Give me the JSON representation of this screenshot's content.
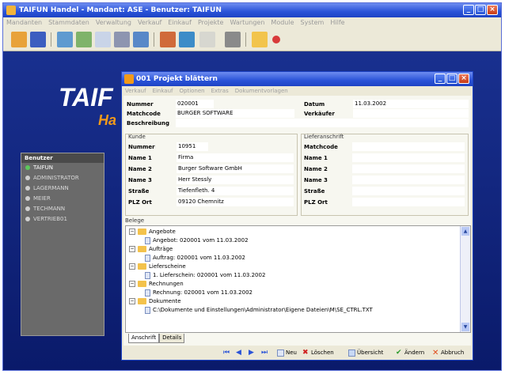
{
  "app": {
    "title": "TAIFUN Handel - Mandant: ASE - Benutzer: TAIFUN",
    "menu": [
      "Mandanten",
      "Stammdaten",
      "Verwaltung",
      "Verkauf",
      "Einkauf",
      "Projekte",
      "Wartungen",
      "Module",
      "System",
      "Hilfe"
    ],
    "brand_line1": "TAIF",
    "brand_line2": "Ha",
    "toolbar_icons": [
      "folder-icon",
      "book-icon",
      "people-icon",
      "chart-icon",
      "document-icon",
      "car-icon",
      "box-icon",
      "archive-icon",
      "calendar-icon",
      "gray-book-icon",
      "folder-plus-icon",
      "pin-icon"
    ]
  },
  "users": {
    "heading": "Benutzer",
    "items": [
      {
        "name": "TAIFUN",
        "active": true
      },
      {
        "name": "ADMINISTRATOR",
        "active": false
      },
      {
        "name": "LAGERMANN",
        "active": false
      },
      {
        "name": "MEIER",
        "active": false
      },
      {
        "name": "TECHMANN",
        "active": false
      },
      {
        "name": "VERTRIEB01",
        "active": false
      }
    ]
  },
  "dialog": {
    "title": "001 Projekt blättern",
    "menu": [
      "Verkauf",
      "Einkauf",
      "Optionen",
      "Extras",
      "Dokumentvorlagen"
    ],
    "header": {
      "nummer_label": "Nummer",
      "nummer": "020001",
      "datum_label": "Datum",
      "datum": "11.03.2002",
      "matchcode_label": "Matchcode",
      "matchcode": "BURGER SOFTWARE",
      "verkaeufer_label": "Verkäufer",
      "verkaeufer": "",
      "beschreibung_label": "Beschreibung",
      "beschreibung": ""
    },
    "kunde": {
      "title": "Kunde",
      "rows": [
        {
          "label": "Nummer",
          "value": "10951"
        },
        {
          "label": "Name 1",
          "value": "Firma"
        },
        {
          "label": "Name 2",
          "value": "Burger Software GmbH"
        },
        {
          "label": "Name 3",
          "value": "Herr Stessly"
        },
        {
          "label": "Straße",
          "value": "Tiefenfleth. 4"
        },
        {
          "label": "PLZ Ort",
          "value": "09120 Chemnitz"
        }
      ]
    },
    "lieferanschrift": {
      "title": "Lieferanschrift",
      "rows": [
        {
          "label": "Matchcode",
          "value": ""
        },
        {
          "label": "Name 1",
          "value": ""
        },
        {
          "label": "Name 2",
          "value": ""
        },
        {
          "label": "Name 3",
          "value": ""
        },
        {
          "label": "Straße",
          "value": ""
        },
        {
          "label": "PLZ Ort",
          "value": ""
        }
      ]
    },
    "belege": {
      "title": "Belege",
      "tree": [
        {
          "level": 0,
          "text": "Angebote"
        },
        {
          "level": 1,
          "text": "Angebot: 020001 vom 11.03.2002"
        },
        {
          "level": 0,
          "text": "Aufträge"
        },
        {
          "level": 1,
          "text": "Auftrag: 020001 vom 11.03.2002"
        },
        {
          "level": 0,
          "text": "Lieferscheine"
        },
        {
          "level": 1,
          "text": "1. Lieferschein: 020001 vom 11.03.2002"
        },
        {
          "level": 0,
          "text": "Rechnungen"
        },
        {
          "level": 1,
          "text": "Rechnung: 020001 vom 11.03.2002"
        },
        {
          "level": 0,
          "text": "Dokumente"
        },
        {
          "level": 1,
          "text": "C:\\Dokumente und Einstellungen\\Administrator\\Eigene Dateien\\M\\SE_CTRL.TXT"
        }
      ]
    },
    "tabs": [
      "Anschrift",
      "Details"
    ],
    "nav": {
      "neu": "Neu",
      "loeschen": "Löschen",
      "uebersicht": "Übersicht",
      "aendern": "Ändern",
      "abbruch": "Abbruch"
    }
  },
  "colors": {
    "titlebar": "#2a53d8",
    "desktop": "#0f1f78",
    "brand_accent": "#f29a1a"
  }
}
